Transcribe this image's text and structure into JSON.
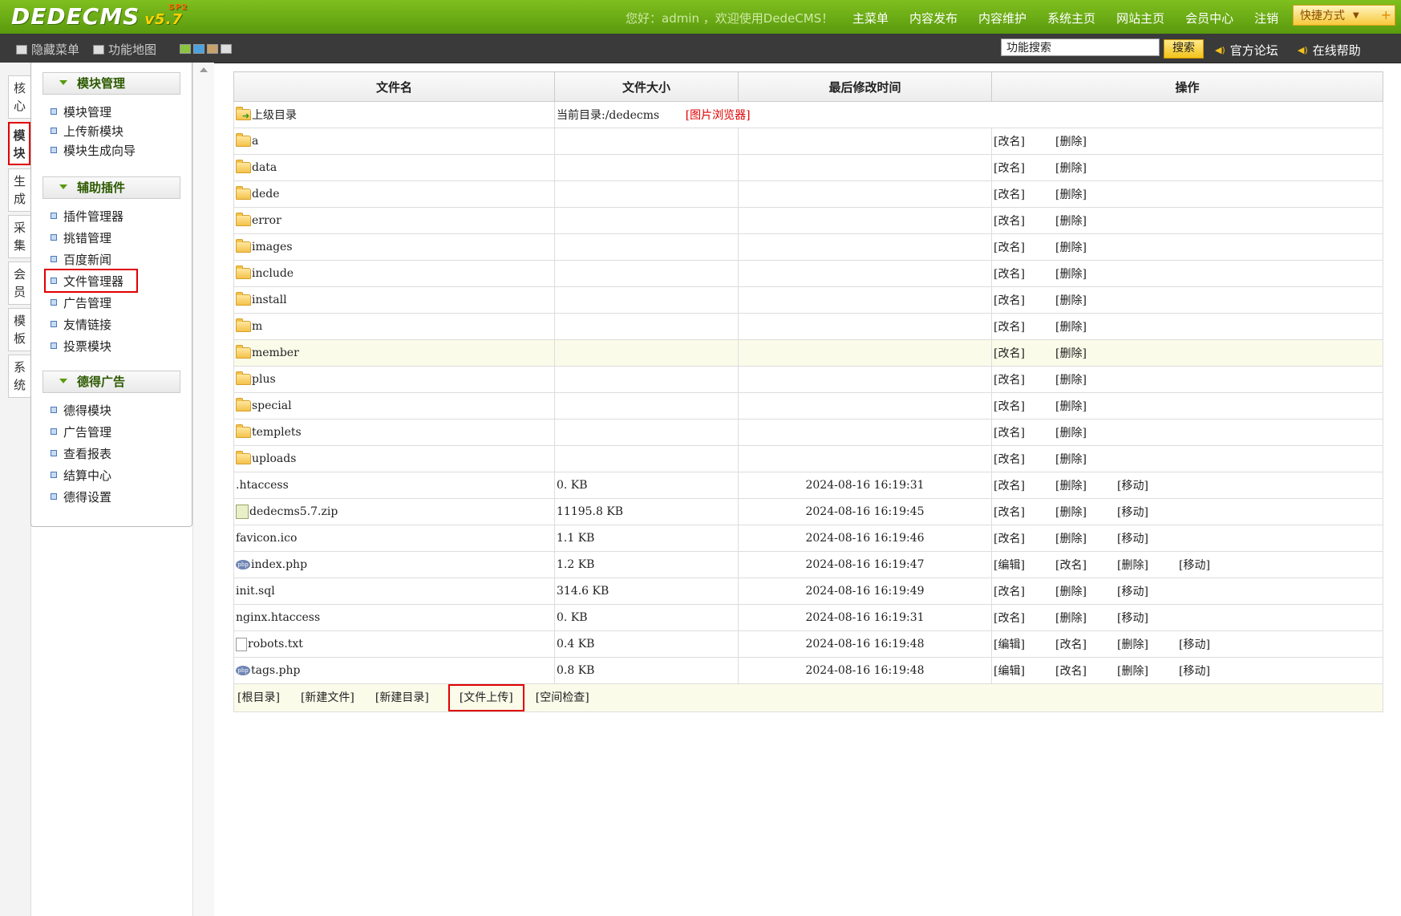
{
  "header": {
    "logo": "DEDECMS",
    "version": "v5.7",
    "version_sup": "SP2",
    "welcome": "您好：admin ，欢迎使用DedeCMS！",
    "nav": [
      "主菜单",
      "内容发布",
      "内容维护",
      "系统主页",
      "网站主页",
      "会员中心",
      "注销"
    ],
    "quick": "快捷方式"
  },
  "subbar": {
    "hide_menu": "隐藏菜单",
    "site_map": "功能地图",
    "search_value": "功能搜索",
    "search_button": "搜索",
    "forum": "官方论坛",
    "help": "在线帮助"
  },
  "vtabs": [
    "核心",
    "模块",
    "生成",
    "采集",
    "会员",
    "模板",
    "系统"
  ],
  "menu": {
    "groups": [
      {
        "title": "模块管理",
        "items": [
          "模块管理",
          "上传新模块",
          "模块生成向导"
        ]
      },
      {
        "title": "辅助插件",
        "items": [
          "插件管理器",
          "挑错管理",
          "百度新闻",
          "文件管理器",
          "广告管理",
          "友情链接",
          "投票模块"
        ]
      },
      {
        "title": "德得广告",
        "items": [
          "德得模块",
          "广告管理",
          "查看报表",
          "结算中心",
          "德得设置"
        ]
      }
    ]
  },
  "table": {
    "headers": [
      "文件名",
      "文件大小",
      "最后修改时间",
      "操作"
    ],
    "parent": {
      "name": "上级目录",
      "current": "当前目录:/dedecms",
      "image_browser": "[图片浏览器]"
    },
    "rows": [
      {
        "name": "a",
        "icon": "folder",
        "size": "",
        "time": "",
        "ops": [
          "[改名]",
          "[删除]"
        ]
      },
      {
        "name": "data",
        "icon": "folder",
        "size": "",
        "time": "",
        "ops": [
          "[改名]",
          "[删除]"
        ]
      },
      {
        "name": "dede",
        "icon": "folder",
        "size": "",
        "time": "",
        "ops": [
          "[改名]",
          "[删除]"
        ]
      },
      {
        "name": "error",
        "icon": "folder",
        "size": "",
        "time": "",
        "ops": [
          "[改名]",
          "[删除]"
        ]
      },
      {
        "name": "images",
        "icon": "folder",
        "size": "",
        "time": "",
        "ops": [
          "[改名]",
          "[删除]"
        ]
      },
      {
        "name": "include",
        "icon": "folder",
        "size": "",
        "time": "",
        "ops": [
          "[改名]",
          "[删除]"
        ]
      },
      {
        "name": "install",
        "icon": "folder",
        "size": "",
        "time": "",
        "ops": [
          "[改名]",
          "[删除]"
        ]
      },
      {
        "name": "m",
        "icon": "folder",
        "size": "",
        "time": "",
        "ops": [
          "[改名]",
          "[删除]"
        ]
      },
      {
        "name": "member",
        "icon": "folder",
        "size": "",
        "time": "",
        "ops": [
          "[改名]",
          "[删除]"
        ],
        "highlight": true
      },
      {
        "name": "plus",
        "icon": "folder",
        "size": "",
        "time": "",
        "ops": [
          "[改名]",
          "[删除]"
        ]
      },
      {
        "name": "special",
        "icon": "folder",
        "size": "",
        "time": "",
        "ops": [
          "[改名]",
          "[删除]"
        ]
      },
      {
        "name": "templets",
        "icon": "folder",
        "size": "",
        "time": "",
        "ops": [
          "[改名]",
          "[删除]"
        ]
      },
      {
        "name": "uploads",
        "icon": "folder",
        "size": "",
        "time": "",
        "ops": [
          "[改名]",
          "[删除]"
        ]
      },
      {
        "name": ".htaccess",
        "icon": "none",
        "size": "0. KB",
        "time": "2024-08-16 16:19:31",
        "ops": [
          "[改名]",
          "[删除]",
          "[移动]"
        ]
      },
      {
        "name": "dedecms5.7.zip",
        "icon": "zip",
        "size": "11195.8 KB",
        "time": "2024-08-16 16:19:45",
        "ops": [
          "[改名]",
          "[删除]",
          "[移动]"
        ]
      },
      {
        "name": "favicon.ico",
        "icon": "none",
        "size": "1.1 KB",
        "time": "2024-08-16 16:19:46",
        "ops": [
          "[改名]",
          "[删除]",
          "[移动]"
        ]
      },
      {
        "name": "index.php",
        "icon": "php",
        "size": "1.2 KB",
        "time": "2024-08-16 16:19:47",
        "ops": [
          "[编辑]",
          "[改名]",
          "[删除]",
          "[移动]"
        ]
      },
      {
        "name": "init.sql",
        "icon": "none",
        "size": "314.6 KB",
        "time": "2024-08-16 16:19:49",
        "ops": [
          "[改名]",
          "[删除]",
          "[移动]"
        ]
      },
      {
        "name": "nginx.htaccess",
        "icon": "none",
        "size": "0. KB",
        "time": "2024-08-16 16:19:31",
        "ops": [
          "[改名]",
          "[删除]",
          "[移动]"
        ]
      },
      {
        "name": "robots.txt",
        "icon": "txt",
        "size": "0.4 KB",
        "time": "2024-08-16 16:19:48",
        "ops": [
          "[编辑]",
          "[改名]",
          "[删除]",
          "[移动]"
        ]
      },
      {
        "name": "tags.php",
        "icon": "php",
        "size": "0.8 KB",
        "time": "2024-08-16 16:19:48",
        "ops": [
          "[编辑]",
          "[改名]",
          "[删除]",
          "[移动]"
        ]
      }
    ],
    "footer": [
      "[根目录]",
      "[新建文件]",
      "[新建目录]",
      "[文件上传]",
      "[空间检查]"
    ]
  }
}
